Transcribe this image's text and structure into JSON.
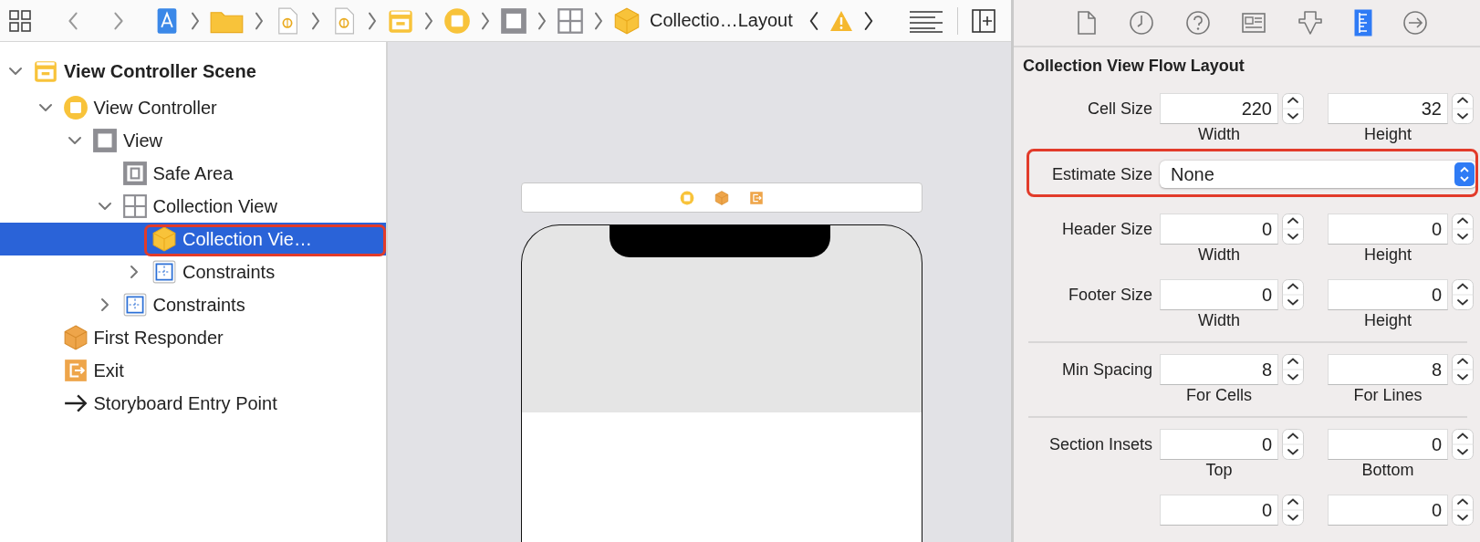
{
  "jump_bar": {
    "crumbs": [
      {
        "kind": "project"
      },
      {
        "kind": "folder"
      },
      {
        "kind": "file"
      },
      {
        "kind": "file"
      },
      {
        "kind": "scene"
      },
      {
        "kind": "controller"
      },
      {
        "kind": "view"
      },
      {
        "kind": "collection"
      },
      {
        "kind": "cell",
        "label": "Collectio…Layout"
      }
    ]
  },
  "outline": [
    {
      "label": "View Controller Scene",
      "kind": "scene",
      "expanded": true,
      "selected": false,
      "annotated": false,
      "children": [
        {
          "label": "View Controller",
          "kind": "controller",
          "expanded": true,
          "selected": false,
          "annotated": false,
          "children": [
            {
              "label": "View",
              "kind": "view",
              "expanded": true,
              "selected": false,
              "annotated": false,
              "children": [
                {
                  "label": "Safe Area",
                  "kind": "safe-area",
                  "selected": false,
                  "annotated": false
                },
                {
                  "label": "Collection View",
                  "kind": "collection",
                  "expanded": true,
                  "selected": false,
                  "annotated": false,
                  "children": [
                    {
                      "label": "Collection Vie…",
                      "kind": "cell",
                      "selected": true,
                      "annotated": true
                    },
                    {
                      "label": "Constraints",
                      "kind": "constraints",
                      "expanded": false,
                      "selected": false,
                      "annotated": false
                    }
                  ]
                },
                {
                  "label": "Constraints",
                  "kind": "constraints",
                  "expanded": false,
                  "selected": false,
                  "annotated": false
                }
              ]
            }
          ]
        },
        {
          "label": "First Responder",
          "kind": "responder",
          "selected": false,
          "annotated": false
        },
        {
          "label": "Exit",
          "kind": "exit",
          "selected": false,
          "annotated": false
        },
        {
          "label": "Storyboard Entry Point",
          "kind": "entry",
          "selected": false,
          "annotated": false
        }
      ]
    }
  ],
  "scene_dock": [
    {
      "kind": "controller"
    },
    {
      "kind": "responder"
    },
    {
      "kind": "exit"
    }
  ],
  "inspector": {
    "tabs": [
      {
        "kind": "file",
        "selected": false
      },
      {
        "kind": "history",
        "selected": false
      },
      {
        "kind": "help",
        "selected": false
      },
      {
        "kind": "identity",
        "selected": false
      },
      {
        "kind": "attributes",
        "selected": false
      },
      {
        "kind": "size",
        "selected": true
      },
      {
        "kind": "connections",
        "selected": false
      }
    ],
    "title": "Collection View Flow Layout",
    "rows": [
      {
        "kind": "pair",
        "label": "Cell Size",
        "annotated": false,
        "fields": [
          {
            "value": "220",
            "caption": "Width"
          },
          {
            "value": "32",
            "caption": "Height"
          }
        ]
      },
      {
        "kind": "popup",
        "label": "Estimate Size",
        "value": "None",
        "annotated": true
      },
      {
        "kind": "pair",
        "label": "Header Size",
        "annotated": false,
        "fields": [
          {
            "value": "0",
            "caption": "Width"
          },
          {
            "value": "0",
            "caption": "Height"
          }
        ]
      },
      {
        "kind": "pair",
        "label": "Footer Size",
        "annotated": false,
        "fields": [
          {
            "value": "0",
            "caption": "Width"
          },
          {
            "value": "0",
            "caption": "Height"
          }
        ]
      },
      {
        "kind": "divider"
      },
      {
        "kind": "pair",
        "label": "Min Spacing",
        "annotated": false,
        "fields": [
          {
            "value": "8",
            "caption": "For Cells"
          },
          {
            "value": "8",
            "caption": "For Lines"
          }
        ]
      },
      {
        "kind": "divider"
      },
      {
        "kind": "pair",
        "label": "Section Insets",
        "annotated": false,
        "fields": [
          {
            "value": "0",
            "caption": "Top"
          },
          {
            "value": "0",
            "caption": "Bottom"
          }
        ]
      },
      {
        "kind": "pair",
        "annotated": false,
        "fields": [
          {
            "value": "0"
          },
          {
            "value": "0"
          }
        ]
      }
    ]
  }
}
